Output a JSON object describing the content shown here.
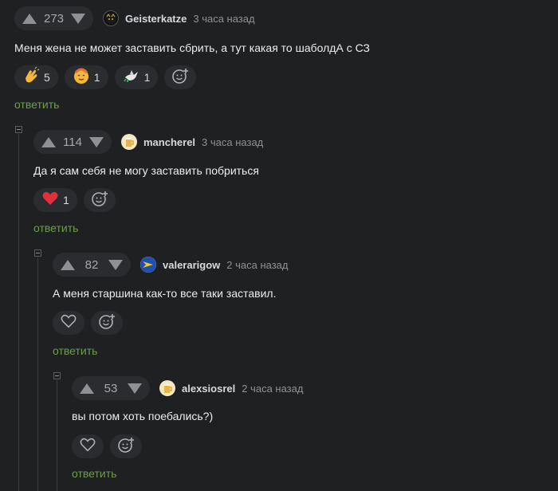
{
  "comments": [
    {
      "score": "273",
      "nick": "Geisterkatze",
      "time": "3 часа назад",
      "text": "Меня жена не может заставить сбрить, а тут какая то шаболдА с СЗ",
      "reactions": [
        {
          "icon": "clapping-hands-icon",
          "count": "5"
        },
        {
          "icon": "smiling-face-icon",
          "count": "1"
        },
        {
          "icon": "dove-icon",
          "count": "1"
        }
      ],
      "reply": "ответить"
    },
    {
      "score": "114",
      "nick": "mancherel",
      "time": "3 часа назад",
      "text": "Да я сам себя не могу заставить побриться",
      "reactions": [
        {
          "icon": "heart-icon",
          "count": "1"
        }
      ],
      "reply": "ответить"
    },
    {
      "score": "82",
      "nick": "valerarigow",
      "time": "2 часа назад",
      "text": "А меня старшина как-то все таки заставил.",
      "reactions": [],
      "reply": "ответить"
    },
    {
      "score": "53",
      "nick": "alexsiosrel",
      "time": "2 часа назад",
      "text": "вы потом хоть поебались?)",
      "reactions": [],
      "reply": "ответить"
    }
  ],
  "colors": {
    "accent_reply": "#6aa04a",
    "heart": "#e0303a",
    "background": "#1f2022"
  }
}
